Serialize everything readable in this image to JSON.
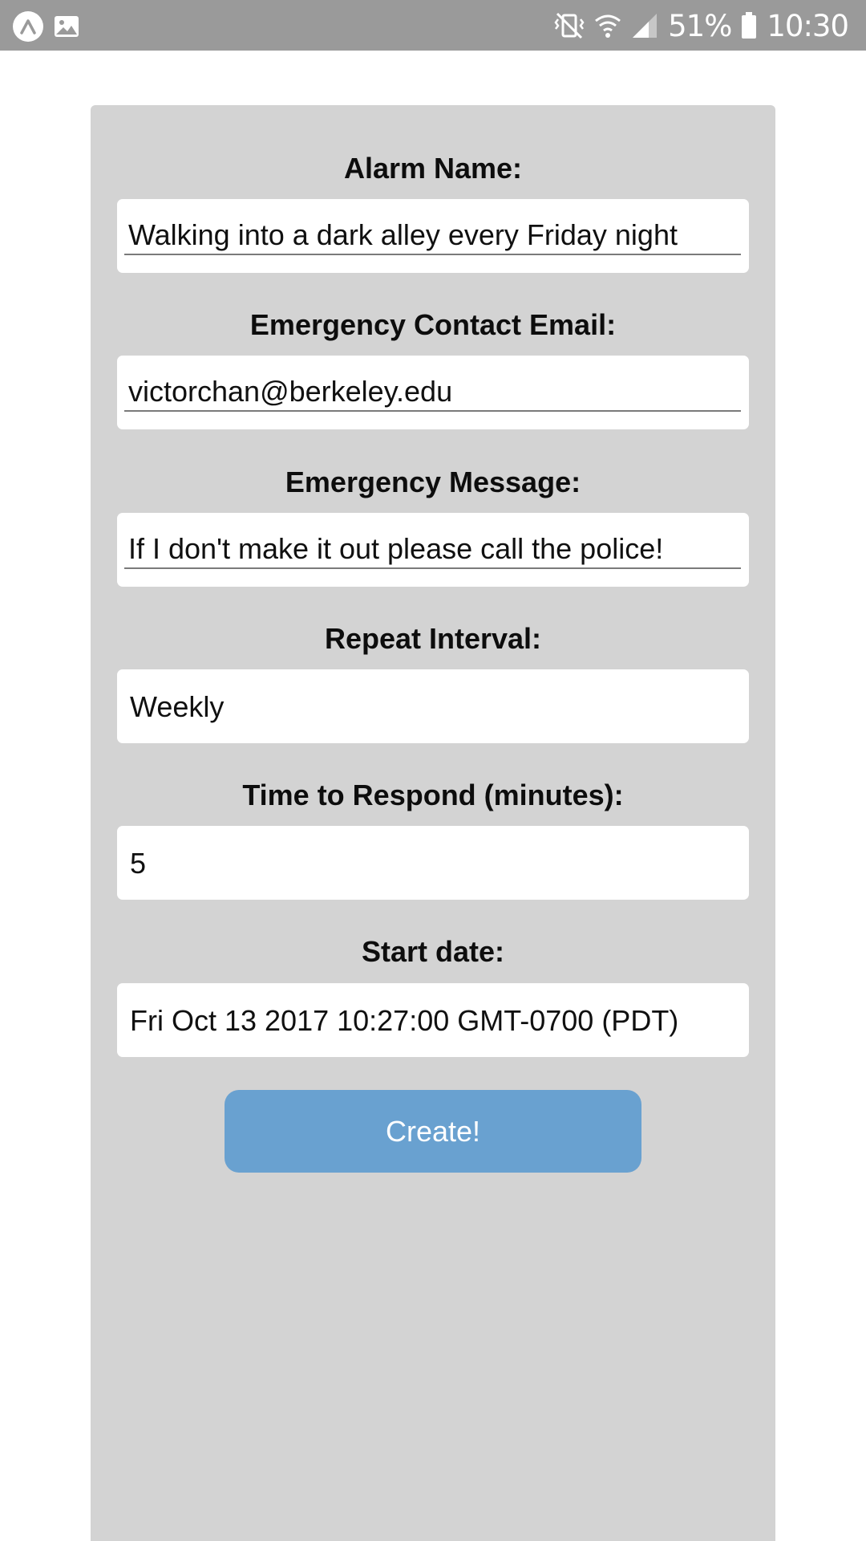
{
  "status_bar": {
    "battery_percent": "51%",
    "time": "10:30",
    "icons": [
      "app-a-icon",
      "image-icon",
      "mute-vibrate-icon",
      "wifi-icon",
      "signal-icon",
      "battery-icon"
    ]
  },
  "form": {
    "alarm_name": {
      "label": "Alarm Name:",
      "value": "Walking into a dark alley every Friday night"
    },
    "contact_email": {
      "label": "Emergency Contact Email:",
      "value": "victorchan@berkeley.edu"
    },
    "emergency_message": {
      "label": "Emergency Message:",
      "value": "If I don't make it out please call the police!"
    },
    "repeat_interval": {
      "label": "Repeat Interval:",
      "value": "Weekly"
    },
    "time_to_respond": {
      "label": "Time to Respond (minutes):",
      "value": "5"
    },
    "start_date": {
      "label": "Start date:",
      "value": "Fri Oct 13 2017 10:27:00 GMT-0700 (PDT)"
    },
    "create_label": "Create!"
  },
  "colors": {
    "status_bar_bg": "#9a9a9a",
    "panel_bg": "#d3d3d3",
    "button_bg": "#69a1d0",
    "field_bg": "#ffffff"
  }
}
